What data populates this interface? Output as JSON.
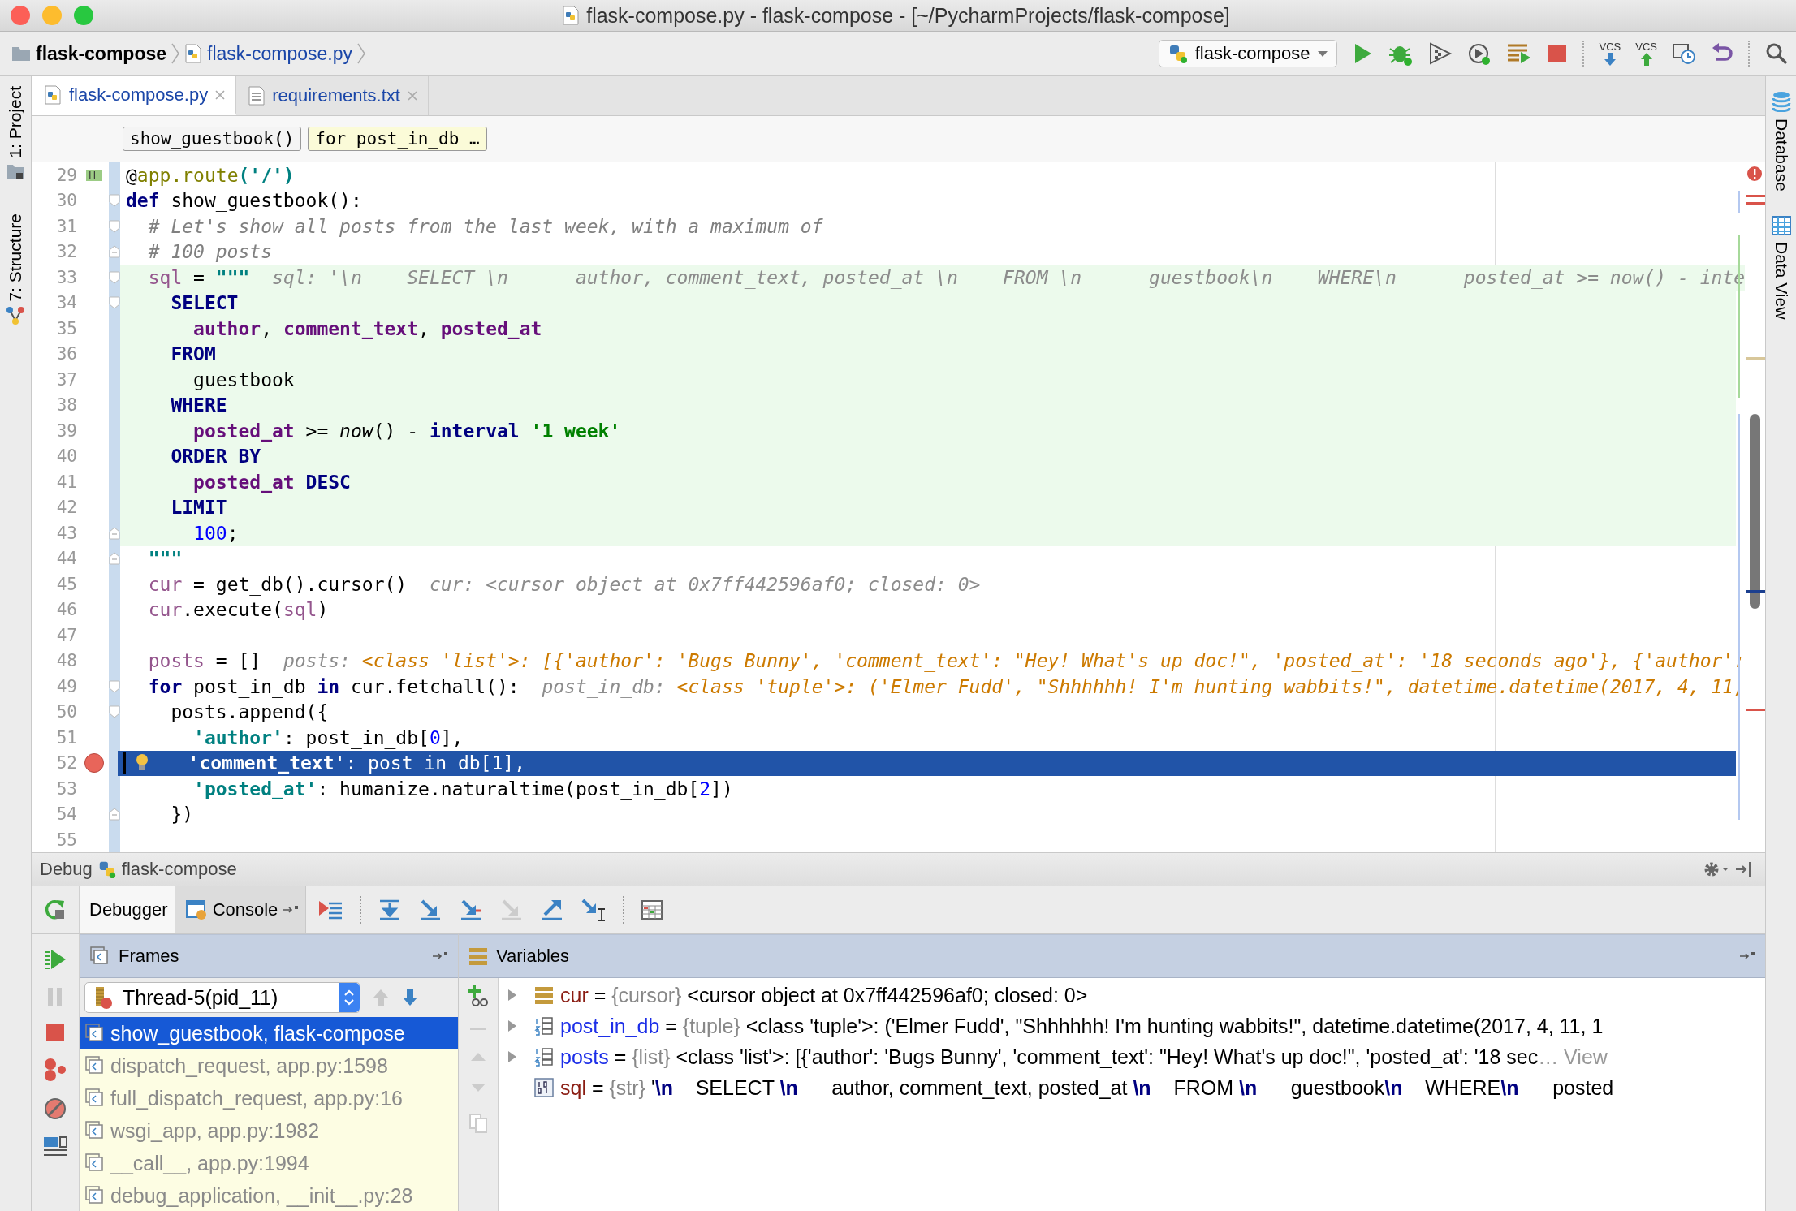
{
  "window": {
    "title": "flask-compose.py - flask-compose - [~/PycharmProjects/flask-compose]"
  },
  "navbar": {
    "breadcrumbs": [
      {
        "label": "flask-compose",
        "kind": "folder"
      },
      {
        "label": "flask-compose.py",
        "kind": "file"
      }
    ],
    "run_config": "flask-compose",
    "vcs_update": "VCS",
    "vcs_commit": "VCS"
  },
  "left_strip": [
    {
      "label": "1: Project"
    },
    {
      "label": "7: Structure"
    }
  ],
  "right_strip": [
    {
      "label": "Database"
    },
    {
      "label": "Data View"
    }
  ],
  "editor_tabs": [
    {
      "label": "flask-compose.py",
      "selected": true
    },
    {
      "label": "requirements.txt",
      "selected": false
    }
  ],
  "scope_chips": [
    {
      "label": "show_guestbook()",
      "selected": false
    },
    {
      "label": "for post_in_db …",
      "selected": true
    }
  ],
  "editor": {
    "lines": [
      {
        "number": "29",
        "badge": "H",
        "code": [
          {
            "text": "@",
            "kind": "plain"
          },
          {
            "text": "app.route",
            "kind": "deco"
          },
          {
            "text": "('/')",
            "kind": "str"
          }
        ]
      },
      {
        "number": "30",
        "fold_open": true,
        "code": [
          {
            "text": "def",
            "kind": "kw"
          },
          {
            "text": " show_guestbook():",
            "kind": "plain"
          }
        ]
      },
      {
        "number": "31",
        "fold_open": true,
        "code": [
          {
            "text": "  # Let's show all posts from the last week, with a maximum of",
            "kind": "comment"
          }
        ]
      },
      {
        "number": "32",
        "fold_close": true,
        "code": [
          {
            "text": "  # 100 posts",
            "kind": "comment"
          }
        ]
      },
      {
        "number": "33",
        "fold_open": true,
        "injected": true,
        "code": [
          {
            "text": "  sql",
            "kind": "var"
          },
          {
            "text": " = ",
            "kind": "plain"
          },
          {
            "text": "\"\"\"",
            "kind": "str"
          }
        ],
        "hint": {
          "label": "sql:",
          "value": "'\\n    SELECT \\n      author, comment_text, posted_at \\n    FROM \\n      guestbook\\n    WHERE\\n      posted_at >= now() - inte",
          "kind": "plain"
        }
      },
      {
        "number": "34",
        "fold_open": true,
        "injected": true,
        "code": [
          {
            "text": "    SELECT",
            "kind": "sqlkw"
          }
        ]
      },
      {
        "number": "35",
        "injected": true,
        "code": [
          {
            "text": "      author",
            "kind": "col"
          },
          {
            "text": ", ",
            "kind": "plain"
          },
          {
            "text": "comment_text",
            "kind": "col"
          },
          {
            "text": ", ",
            "kind": "plain"
          },
          {
            "text": "posted_at",
            "kind": "col"
          }
        ]
      },
      {
        "number": "36",
        "injected": true,
        "code": [
          {
            "text": "    FROM",
            "kind": "sqlkw"
          }
        ]
      },
      {
        "number": "37",
        "injected": true,
        "code": [
          {
            "text": "      guestbook",
            "kind": "plain"
          }
        ]
      },
      {
        "number": "38",
        "injected": true,
        "code": [
          {
            "text": "    WHERE",
            "kind": "sqlkw"
          }
        ]
      },
      {
        "number": "39",
        "injected": true,
        "code": [
          {
            "text": "      posted_at",
            "kind": "col"
          },
          {
            "text": " >= ",
            "kind": "plain"
          },
          {
            "text": "now",
            "kind": "italic"
          },
          {
            "text": "() - ",
            "kind": "plain"
          },
          {
            "text": "interval",
            "kind": "sqlkw"
          },
          {
            "text": " '1 week'",
            "kind": "sqlstr"
          }
        ]
      },
      {
        "number": "40",
        "injected": true,
        "code": [
          {
            "text": "    ORDER BY",
            "kind": "sqlkw"
          }
        ]
      },
      {
        "number": "41",
        "injected": true,
        "code": [
          {
            "text": "      posted_at",
            "kind": "col"
          },
          {
            "text": " DESC",
            "kind": "sqlkw"
          }
        ]
      },
      {
        "number": "42",
        "injected": true,
        "code": [
          {
            "text": "    LIMIT",
            "kind": "sqlkw"
          }
        ]
      },
      {
        "number": "43",
        "fold_close": true,
        "injected": true,
        "code": [
          {
            "text": "      100",
            "kind": "num"
          },
          {
            "text": ";",
            "kind": "plain"
          }
        ]
      },
      {
        "number": "44",
        "fold_close": true,
        "code": [
          {
            "text": "  \"\"\"",
            "kind": "str"
          }
        ]
      },
      {
        "number": "45",
        "code": [
          {
            "text": "  cur",
            "kind": "var"
          },
          {
            "text": " = get_db().cursor()",
            "kind": "plain"
          }
        ],
        "hint": {
          "label": "cur:",
          "value": "<cursor object at 0x7ff442596af0; closed: 0>",
          "kind": "plain"
        }
      },
      {
        "number": "46",
        "code": [
          {
            "text": "  cur",
            "kind": "var"
          },
          {
            "text": ".execute(",
            "kind": "plain"
          },
          {
            "text": "sql",
            "kind": "var"
          },
          {
            "text": ")",
            "kind": "plain"
          }
        ]
      },
      {
        "number": "47"
      },
      {
        "number": "48",
        "code": [
          {
            "text": "  posts",
            "kind": "var"
          },
          {
            "text": " = []",
            "kind": "plain"
          }
        ],
        "hint": {
          "label": "posts:",
          "value": "<class 'list'>: [{'author': 'Bugs Bunny', 'comment_text': \"Hey! What's up doc!\", 'posted_at': '18 seconds ago'}, {'author':",
          "kind": "typed"
        }
      },
      {
        "number": "49",
        "fold_open": true,
        "code": [
          {
            "text": "  for",
            "kind": "kw"
          },
          {
            "text": " post_in_db ",
            "kind": "plain"
          },
          {
            "text": "in",
            "kind": "kw"
          },
          {
            "text": " cur.fetchall():",
            "kind": "plain"
          }
        ],
        "hint": {
          "label": "post_in_db:",
          "value": "<class 'tuple'>: ('Elmer Fudd', \"Shhhhhh! I'm hunting wabbits!\", datetime.datetime(2017, 4, 11,",
          "kind": "typed"
        }
      },
      {
        "number": "50",
        "fold_open": true,
        "code": [
          {
            "text": "    posts.append({",
            "kind": "plain"
          }
        ]
      },
      {
        "number": "51",
        "code": [
          {
            "text": "      'author'",
            "kind": "str"
          },
          {
            "text": ": post_in_db[",
            "kind": "plain"
          },
          {
            "text": "0",
            "kind": "num"
          },
          {
            "text": "],",
            "kind": "plain"
          }
        ]
      },
      {
        "number": "52",
        "breakpoint": true,
        "current": true,
        "code": [
          {
            "text": "   'comment_text'",
            "kind": "str"
          },
          {
            "text": ": post_in_db[",
            "kind": "plain"
          },
          {
            "text": "1",
            "kind": "num"
          },
          {
            "text": "],",
            "kind": "plain"
          }
        ]
      },
      {
        "number": "53",
        "code": [
          {
            "text": "      'posted_at'",
            "kind": "str"
          },
          {
            "text": ": humanize.naturaltime(post_in_db[",
            "kind": "plain"
          },
          {
            "text": "2",
            "kind": "num"
          },
          {
            "text": "])",
            "kind": "plain"
          }
        ]
      },
      {
        "number": "54",
        "fold_close": true,
        "code": [
          {
            "text": "    })",
            "kind": "plain"
          }
        ]
      },
      {
        "number": "55"
      }
    ]
  },
  "debug": {
    "label": "Debug",
    "config": "flask-compose",
    "tabs": [
      {
        "label": "Debugger",
        "selected": true
      },
      {
        "label": "Console",
        "selected": false
      }
    ],
    "frames_title": "Frames",
    "variables_title": "Variables",
    "thread": "Thread-5(pid_11)",
    "frames": [
      {
        "label": "show_guestbook, flask-compose",
        "selected": true
      },
      {
        "label": "dispatch_request, app.py:1598",
        "selected": false
      },
      {
        "label": "full_dispatch_request, app.py:16",
        "selected": false
      },
      {
        "label": "wsgi_app, app.py:1982",
        "selected": false
      },
      {
        "label": "__call__, app.py:1994",
        "selected": false
      },
      {
        "label": "debug_application, __init__.py:28",
        "selected": false
      }
    ],
    "variables": [
      {
        "name": "cur",
        "sign": "=",
        "type": "{cursor}",
        "value": "<cursor object at 0x7ff442596af0; closed: 0>",
        "kind": "object",
        "expandable": true
      },
      {
        "name": "post_in_db",
        "sign": "=",
        "type": "{tuple}",
        "value": "<class 'tuple'>: ('Elmer Fudd', \"Shhhhhh! I'm hunting wabbits!\", datetime.datetime(2017, 4, 11, 1",
        "kind": "sequence",
        "expandable": true
      },
      {
        "name": "posts",
        "sign": "=",
        "type": "{list}",
        "value": "<class 'list'>: [{'author': 'Bugs Bunny', 'comment_text': \"Hey! What's up doc!\", 'posted_at': '18 sec",
        "more": "… View",
        "kind": "sequence",
        "expandable": true
      },
      {
        "name": "sql",
        "sign": "=",
        "type": "{str}",
        "value": "'**\\n**    SELECT **\\n**      author, comment_text, posted_at **\\n**    FROM **\\n**      guestbook**\\n**    WHERE**\\n**      posted",
        "kind": "string",
        "expandable": false
      }
    ]
  }
}
